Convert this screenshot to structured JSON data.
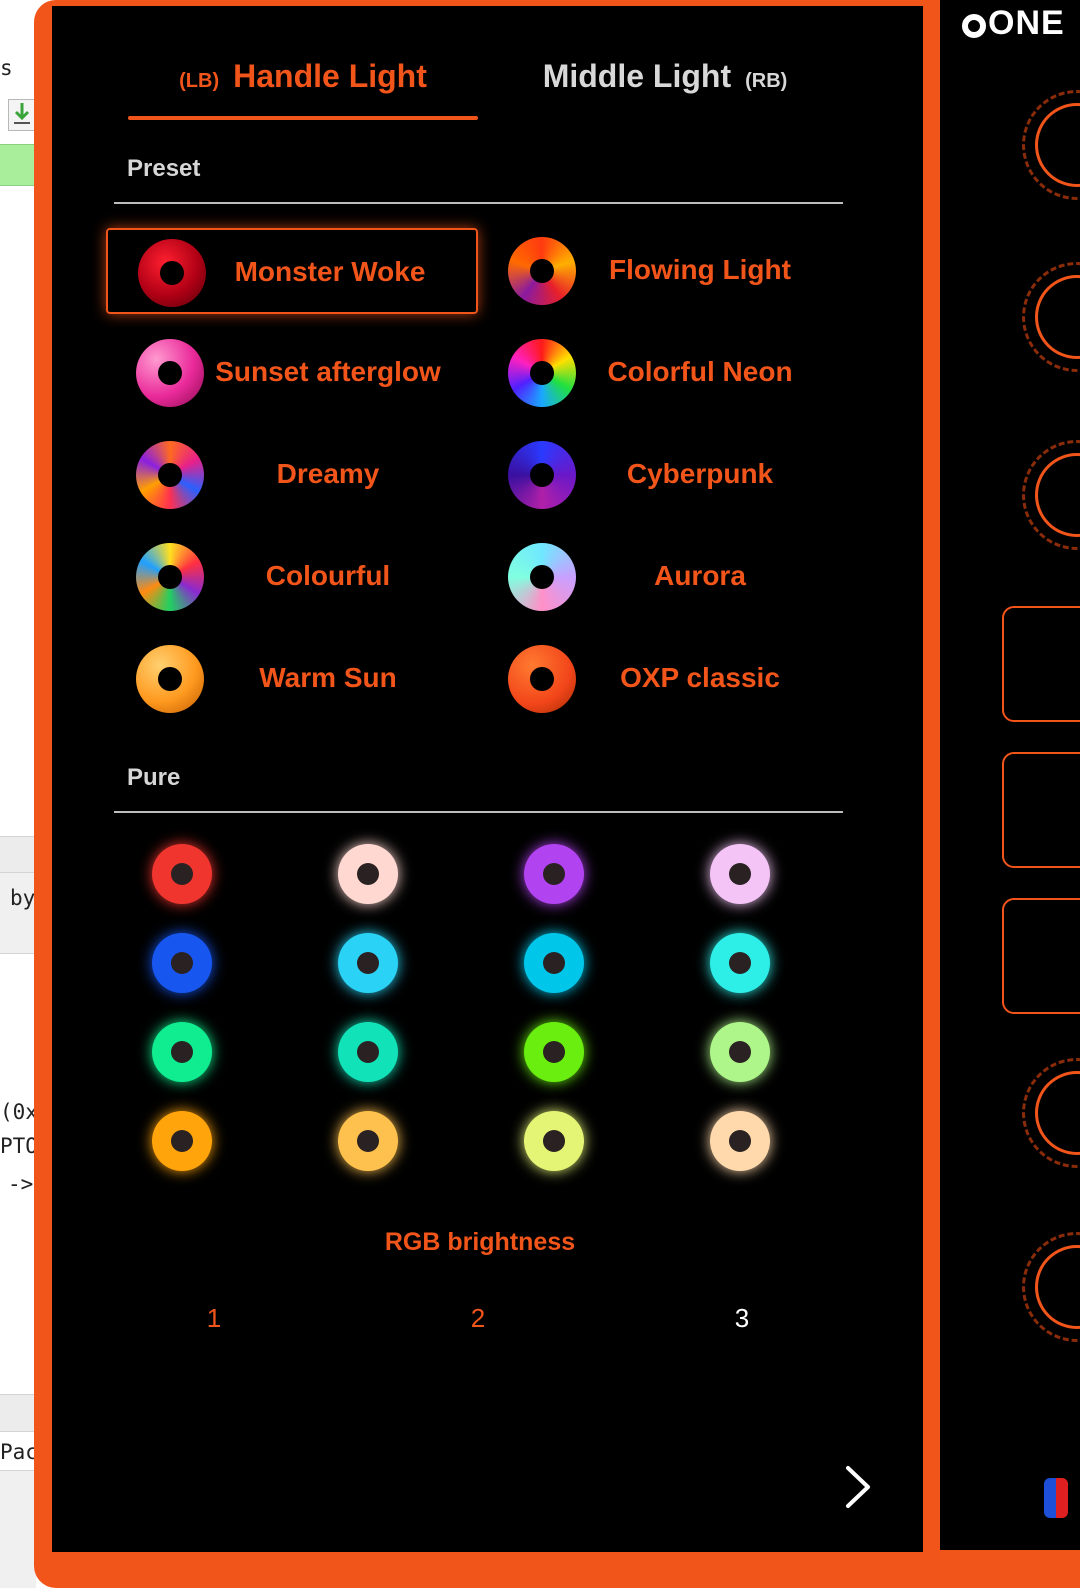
{
  "app": {
    "brand": "ONE"
  },
  "background_window": {
    "lines": [
      {
        "text": "s"
      },
      {
        "text": "by"
      },
      {
        "text": "(0x"
      },
      {
        "text": "PTO"
      },
      {
        "text": "->"
      },
      {
        "text": "Pac"
      }
    ]
  },
  "tabs": [
    {
      "key": "(LB)",
      "label": "Handle Light",
      "active": true
    },
    {
      "key": "(RB)",
      "label": "Middle Light",
      "active": false
    }
  ],
  "preset": {
    "title": "Preset",
    "items": [
      {
        "label": "Monster Woke",
        "selected": true
      },
      {
        "label": "Flowing Light",
        "selected": false
      },
      {
        "label": "Sunset afterglow",
        "selected": false
      },
      {
        "label": "Colorful Neon",
        "selected": false
      },
      {
        "label": "Dreamy",
        "selected": false
      },
      {
        "label": "Cyberpunk",
        "selected": false
      },
      {
        "label": "Colourful",
        "selected": false
      },
      {
        "label": "Aurora",
        "selected": false
      },
      {
        "label": "Warm Sun",
        "selected": false
      },
      {
        "label": "OXP classic",
        "selected": false
      }
    ]
  },
  "pure": {
    "title": "Pure",
    "colors": [
      "#f0352e",
      "#ffd8d2",
      "#b243f0",
      "#f4c4f6",
      "#1757f0",
      "#2ad2f6",
      "#00c6ea",
      "#2eeee8",
      "#10ec90",
      "#12e2b8",
      "#6aee10",
      "#aef58a",
      "#ffa40a",
      "#ffc14e",
      "#e4f575",
      "#ffd9ac"
    ]
  },
  "brightness": {
    "title": "RGB brightness",
    "options": [
      "1",
      "2",
      "3"
    ],
    "selected": "3"
  },
  "colors": {
    "accent": "#f2551a",
    "panel": "#000000",
    "inactive_tab": "#d8d8d8"
  },
  "icons": {
    "next": "chevron-right-icon",
    "download": "download-icon"
  }
}
